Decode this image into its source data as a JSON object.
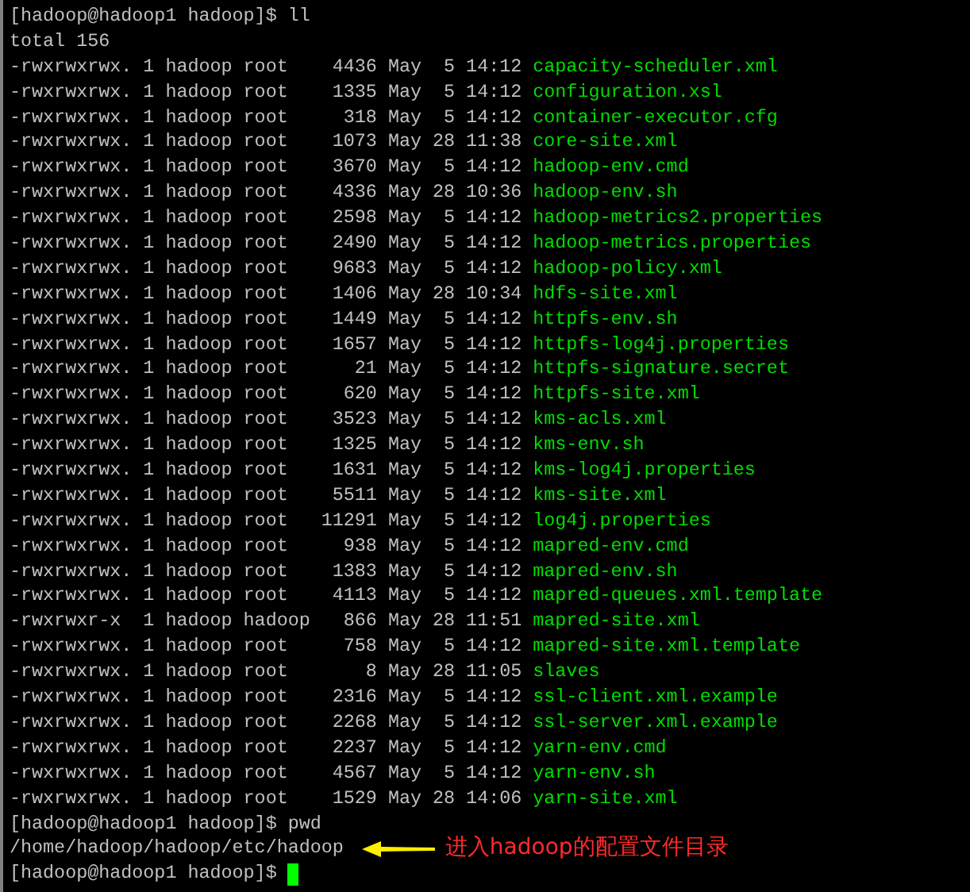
{
  "lines": [
    {
      "kind": "prompt",
      "prompt": "[hadoop@hadoop1 hadoop]$",
      "command": "ll"
    },
    {
      "kind": "output",
      "text": "total 156"
    },
    {
      "kind": "file",
      "info": "-rwxrwxrwx. 1 hadoop root    4436 May  5 14:12",
      "name": "capacity-scheduler.xml"
    },
    {
      "kind": "file",
      "info": "-rwxrwxrwx. 1 hadoop root    1335 May  5 14:12",
      "name": "configuration.xsl"
    },
    {
      "kind": "file",
      "info": "-rwxrwxrwx. 1 hadoop root     318 May  5 14:12",
      "name": "container-executor.cfg"
    },
    {
      "kind": "file",
      "info": "-rwxrwxrwx. 1 hadoop root    1073 May 28 11:38",
      "name": "core-site.xml"
    },
    {
      "kind": "file",
      "info": "-rwxrwxrwx. 1 hadoop root    3670 May  5 14:12",
      "name": "hadoop-env.cmd"
    },
    {
      "kind": "file",
      "info": "-rwxrwxrwx. 1 hadoop root    4336 May 28 10:36",
      "name": "hadoop-env.sh"
    },
    {
      "kind": "file",
      "info": "-rwxrwxrwx. 1 hadoop root    2598 May  5 14:12",
      "name": "hadoop-metrics2.properties"
    },
    {
      "kind": "file",
      "info": "-rwxrwxrwx. 1 hadoop root    2490 May  5 14:12",
      "name": "hadoop-metrics.properties"
    },
    {
      "kind": "file",
      "info": "-rwxrwxrwx. 1 hadoop root    9683 May  5 14:12",
      "name": "hadoop-policy.xml"
    },
    {
      "kind": "file",
      "info": "-rwxrwxrwx. 1 hadoop root    1406 May 28 10:34",
      "name": "hdfs-site.xml"
    },
    {
      "kind": "file",
      "info": "-rwxrwxrwx. 1 hadoop root    1449 May  5 14:12",
      "name": "httpfs-env.sh"
    },
    {
      "kind": "file",
      "info": "-rwxrwxrwx. 1 hadoop root    1657 May  5 14:12",
      "name": "httpfs-log4j.properties"
    },
    {
      "kind": "file",
      "info": "-rwxrwxrwx. 1 hadoop root      21 May  5 14:12",
      "name": "httpfs-signature.secret"
    },
    {
      "kind": "file",
      "info": "-rwxrwxrwx. 1 hadoop root     620 May  5 14:12",
      "name": "httpfs-site.xml"
    },
    {
      "kind": "file",
      "info": "-rwxrwxrwx. 1 hadoop root    3523 May  5 14:12",
      "name": "kms-acls.xml"
    },
    {
      "kind": "file",
      "info": "-rwxrwxrwx. 1 hadoop root    1325 May  5 14:12",
      "name": "kms-env.sh"
    },
    {
      "kind": "file",
      "info": "-rwxrwxrwx. 1 hadoop root    1631 May  5 14:12",
      "name": "kms-log4j.properties"
    },
    {
      "kind": "file",
      "info": "-rwxrwxrwx. 1 hadoop root    5511 May  5 14:12",
      "name": "kms-site.xml"
    },
    {
      "kind": "file",
      "info": "-rwxrwxrwx. 1 hadoop root   11291 May  5 14:12",
      "name": "log4j.properties"
    },
    {
      "kind": "file",
      "info": "-rwxrwxrwx. 1 hadoop root     938 May  5 14:12",
      "name": "mapred-env.cmd"
    },
    {
      "kind": "file",
      "info": "-rwxrwxrwx. 1 hadoop root    1383 May  5 14:12",
      "name": "mapred-env.sh"
    },
    {
      "kind": "file",
      "info": "-rwxrwxrwx. 1 hadoop root    4113 May  5 14:12",
      "name": "mapred-queues.xml.template"
    },
    {
      "kind": "file",
      "info": "-rwxrwxr-x  1 hadoop hadoop   866 May 28 11:51",
      "name": "mapred-site.xml"
    },
    {
      "kind": "file",
      "info": "-rwxrwxrwx. 1 hadoop root     758 May  5 14:12",
      "name": "mapred-site.xml.template"
    },
    {
      "kind": "file",
      "info": "-rwxrwxrwx. 1 hadoop root       8 May 28 11:05",
      "name": "slaves"
    },
    {
      "kind": "file",
      "info": "-rwxrwxrwx. 1 hadoop root    2316 May  5 14:12",
      "name": "ssl-client.xml.example"
    },
    {
      "kind": "file",
      "info": "-rwxrwxrwx. 1 hadoop root    2268 May  5 14:12",
      "name": "ssl-server.xml.example"
    },
    {
      "kind": "file",
      "info": "-rwxrwxrwx. 1 hadoop root    2237 May  5 14:12",
      "name": "yarn-env.cmd"
    },
    {
      "kind": "file",
      "info": "-rwxrwxrwx. 1 hadoop root    4567 May  5 14:12",
      "name": "yarn-env.sh"
    },
    {
      "kind": "file",
      "info": "-rwxrwxrwx. 1 hadoop root    1529 May 28 14:06",
      "name": "yarn-site.xml"
    },
    {
      "kind": "prompt",
      "prompt": "[hadoop@hadoop1 hadoop]$",
      "command": "pwd"
    },
    {
      "kind": "output",
      "text": "/home/hadoop/hadoop/etc/hadoop",
      "annotation": "进入hadoop的配置文件目录"
    },
    {
      "kind": "prompt",
      "prompt": "[hadoop@hadoop1 hadoop]$",
      "cursor": true
    }
  ]
}
